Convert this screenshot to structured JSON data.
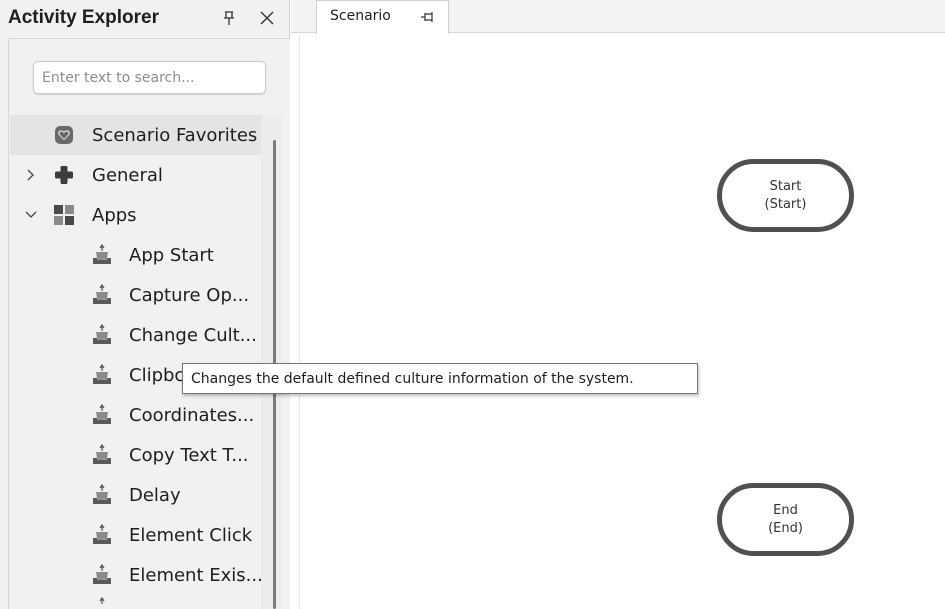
{
  "activity_explorer": {
    "title": "Activity Explorer",
    "pin_icon": "pin-icon",
    "close_icon": "close-icon",
    "search": {
      "placeholder": "Enter text to search...",
      "value": ""
    },
    "favorites": {
      "label": "Scenario Favorites",
      "icon": "favorites-icon"
    },
    "categories": [
      {
        "label": "General",
        "icon": "general-icon",
        "expanded": false
      },
      {
        "label": "Apps",
        "icon": "apps-icon",
        "expanded": true
      }
    ],
    "apps_items": [
      "App Start",
      "Capture Op...",
      "Change Cult...",
      "Clipbc",
      "Coordinates...",
      "Copy Text T...",
      "Delay",
      "Element Click",
      "Element Exis..."
    ]
  },
  "document": {
    "tab_label": "Scenario",
    "tab_pin_icon": "pin-icon"
  },
  "canvas": {
    "start_node": {
      "line1": "Start",
      "line2": "(Start)"
    },
    "end_node": {
      "line1": "End",
      "line2": "(End)"
    }
  },
  "tooltip": {
    "text": "Changes the default defined culture information of the system."
  },
  "colors": {
    "panel_bg": "#f1f1f1",
    "node_border": "#505050",
    "selected_row": "#e4e4e4"
  }
}
